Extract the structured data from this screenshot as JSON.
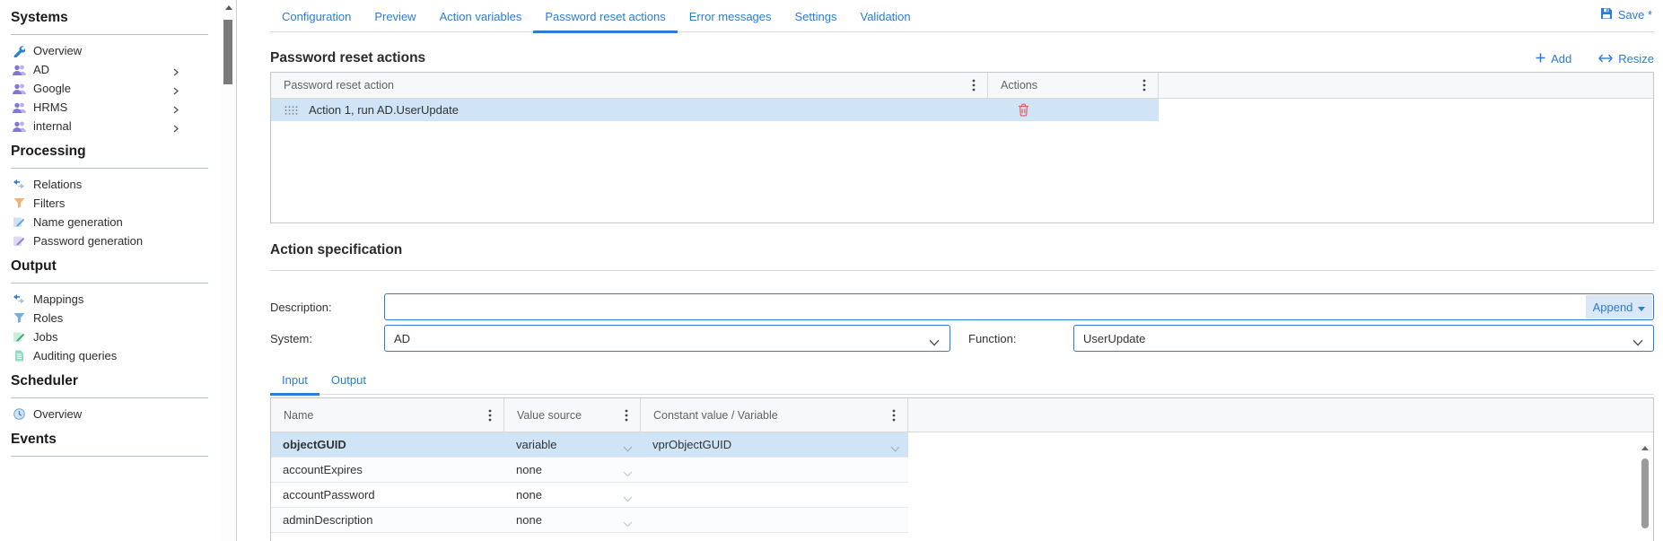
{
  "colors": {
    "accent": "#2b7cd6",
    "selected_row": "#cfe4f7",
    "delete_icon": "#e06060"
  },
  "sidebar": {
    "sections": [
      {
        "title": "Systems",
        "items": [
          {
            "label": "Overview",
            "icon": "wrench-icon"
          },
          {
            "label": "AD",
            "icon": "users-icon",
            "expandable": true
          },
          {
            "label": "Google",
            "icon": "users-icon",
            "expandable": true
          },
          {
            "label": "HRMS",
            "icon": "users-icon",
            "expandable": true
          },
          {
            "label": "internal",
            "icon": "users-icon",
            "expandable": true
          }
        ]
      },
      {
        "title": "Processing",
        "items": [
          {
            "label": "Relations",
            "icon": "relations-arrows-icon"
          },
          {
            "label": "Filters",
            "icon": "filter-funnel-icon"
          },
          {
            "label": "Name generation",
            "icon": "name-generation-icon"
          },
          {
            "label": "Password generation",
            "icon": "password-generation-icon"
          }
        ]
      },
      {
        "title": "Output",
        "items": [
          {
            "label": "Mappings",
            "icon": "mappings-arrows-icon"
          },
          {
            "label": "Roles",
            "icon": "roles-funnel-icon"
          },
          {
            "label": "Jobs",
            "icon": "jobs-icon"
          },
          {
            "label": "Auditing queries",
            "icon": "auditing-queries-icon"
          }
        ]
      },
      {
        "title": "Scheduler",
        "items": [
          {
            "label": "Overview",
            "icon": "clock-icon"
          }
        ]
      },
      {
        "title": "Events",
        "items": []
      }
    ]
  },
  "header": {
    "tabs": [
      "Configuration",
      "Preview",
      "Action variables",
      "Password reset actions",
      "Error messages",
      "Settings",
      "Validation"
    ],
    "active_tab": "Password reset actions",
    "save_label": "Save *"
  },
  "reset_actions": {
    "title": "Password reset actions",
    "add_label": "Add",
    "resize_label": "Resize",
    "table": {
      "col_action": "Password reset action",
      "col_actions": "Actions",
      "rows": [
        {
          "label": "Action 1, run AD.UserUpdate"
        }
      ]
    }
  },
  "action_spec": {
    "title": "Action specification",
    "description_label": "Description:",
    "description_value": "",
    "append_label": "Append",
    "system_label": "System:",
    "system_value": "AD",
    "function_label": "Function:",
    "function_value": "UserUpdate",
    "io_tabs": [
      "Input",
      "Output"
    ],
    "active_io_tab": "Input",
    "params_table": {
      "col_name": "Name",
      "col_source": "Value source",
      "col_value": "Constant value / Variable",
      "rows": [
        {
          "name": "objectGUID",
          "source": "variable",
          "value": "vprObjectGUID",
          "selected": true
        },
        {
          "name": "accountExpires",
          "source": "none",
          "value": ""
        },
        {
          "name": "accountPassword",
          "source": "none",
          "value": ""
        },
        {
          "name": "adminDescription",
          "source": "none",
          "value": ""
        }
      ]
    }
  }
}
